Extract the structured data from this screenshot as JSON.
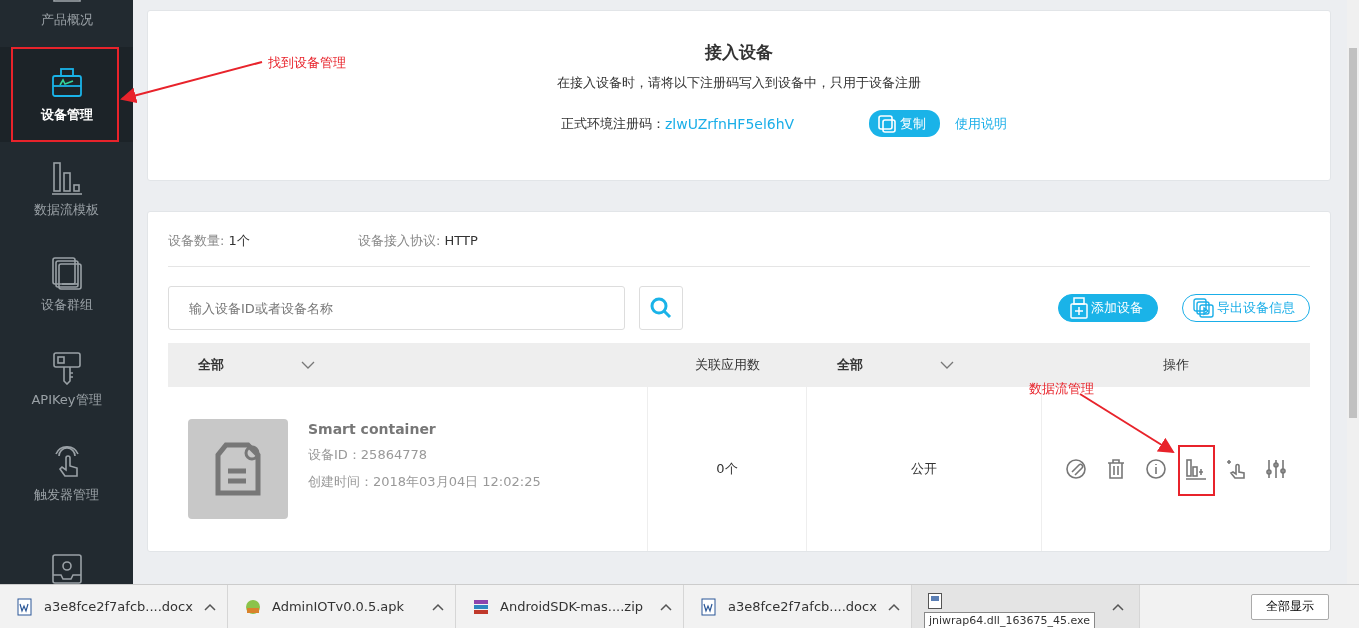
{
  "sidebar": {
    "items": [
      {
        "label": "产品概况",
        "kind": "overview",
        "selected": false
      },
      {
        "label": "设备管理",
        "kind": "device",
        "selected": true
      },
      {
        "label": "数据流模板",
        "kind": "datastream",
        "selected": false
      },
      {
        "label": "设备群组",
        "kind": "group",
        "selected": false
      },
      {
        "label": "APIKey管理",
        "kind": "key",
        "selected": false
      },
      {
        "label": "触发器管理",
        "kind": "trigger",
        "selected": false
      },
      {
        "kind": "app",
        "selected": false
      }
    ]
  },
  "access_card": {
    "title": "接入设备",
    "description": "在接入设备时，请将以下注册码写入到设备中，只用于设备注册",
    "code_label": "正式环境注册码：",
    "code_value": "zlwUZrfnHF5el6hV",
    "copy_button": "复制",
    "help_link": "使用说明"
  },
  "device_list": {
    "count_label": "设备数量:",
    "count_value": "1个",
    "protocol_label": "设备接入协议:",
    "protocol_value": "HTTP",
    "search": {
      "placeholder": "输入设备ID或者设备名称"
    },
    "add_button": "添加设备",
    "export_button": "导出设备信息",
    "columns": [
      {
        "label": "全部",
        "kind": "filter"
      },
      {
        "label": "关联应用数",
        "kind": "plain"
      },
      {
        "label": "全部",
        "kind": "filter"
      },
      {
        "label": "操作",
        "kind": "plain"
      }
    ],
    "rows": [
      {
        "name": "Smart container",
        "device_id": "设备ID：25864778",
        "created": "创建时间：2018年03月04日 12:02:25",
        "apps": "0个",
        "visibility": "公开",
        "actions": [
          {
            "kind": "edit"
          },
          {
            "kind": "delete"
          },
          {
            "kind": "info"
          },
          {
            "kind": "datastream"
          },
          {
            "kind": "trigger"
          },
          {
            "kind": "settings"
          }
        ]
      }
    ]
  },
  "annotations": [
    {
      "text": "找到设备管理"
    },
    {
      "text": "数据流管理"
    }
  ],
  "downloads": {
    "items": [
      {
        "name": "a3e8fce2f7afcb....docx",
        "kind": "word"
      },
      {
        "name": "AdminIOTv0.0.5.apk",
        "kind": "apk"
      },
      {
        "name": "AndroidSDK-mas....zip",
        "kind": "zip"
      },
      {
        "name": "a3e8fce2f7afcb....docx",
        "kind": "word"
      },
      {
        "kind": "exe",
        "tooltip": "jniwrap64.dll_163675_45.exe"
      }
    ],
    "show_all_button": "全部显示"
  }
}
